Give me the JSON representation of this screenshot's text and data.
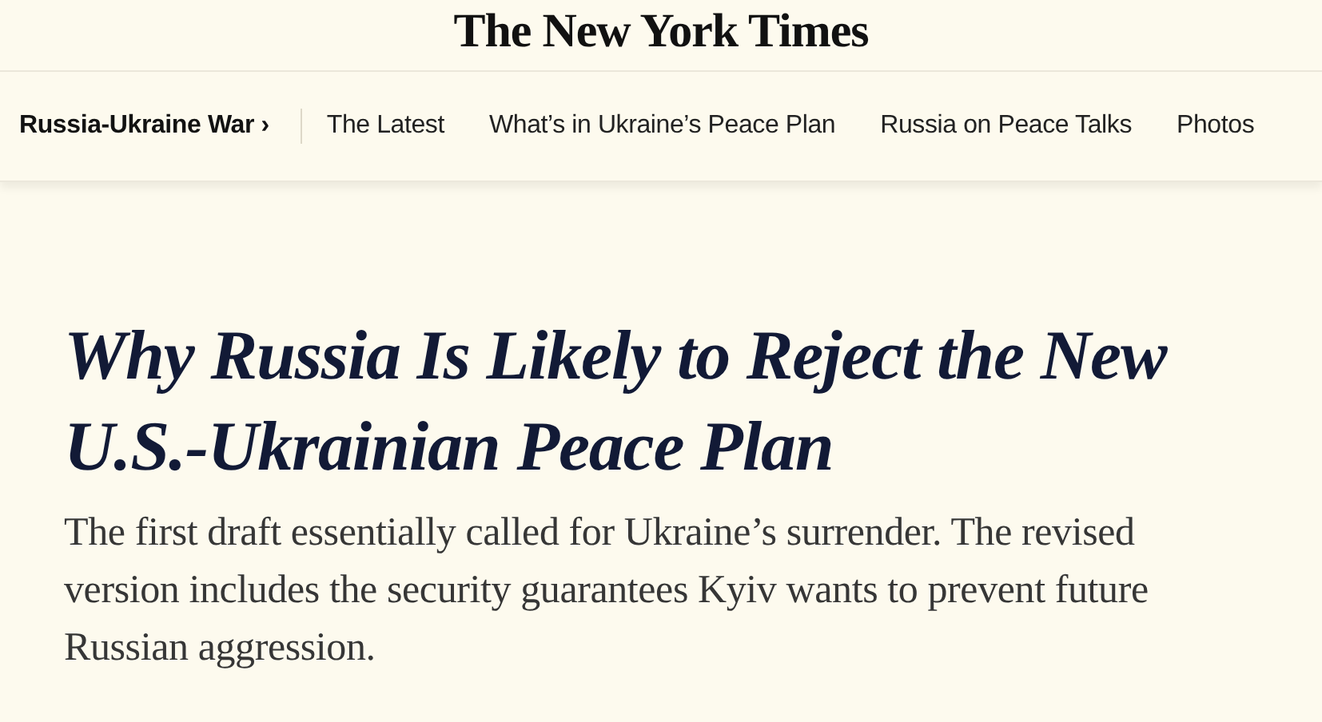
{
  "masthead": {
    "logo": "The New York Times"
  },
  "nav": {
    "section": "Russia-Ukraine War",
    "chevron": "›",
    "links": [
      "The Latest",
      "What’s in Ukraine’s Peace Plan",
      "Russia on Peace Talks",
      "Photos"
    ]
  },
  "article": {
    "headline": "Why Russia Is Likely to Reject the New U.S.-Ukrainian Peace Plan",
    "summary": "The first draft essentially called for Ukraine’s surrender. The revised version includes the security guarantees Kyiv wants to prevent future Russian aggression."
  }
}
